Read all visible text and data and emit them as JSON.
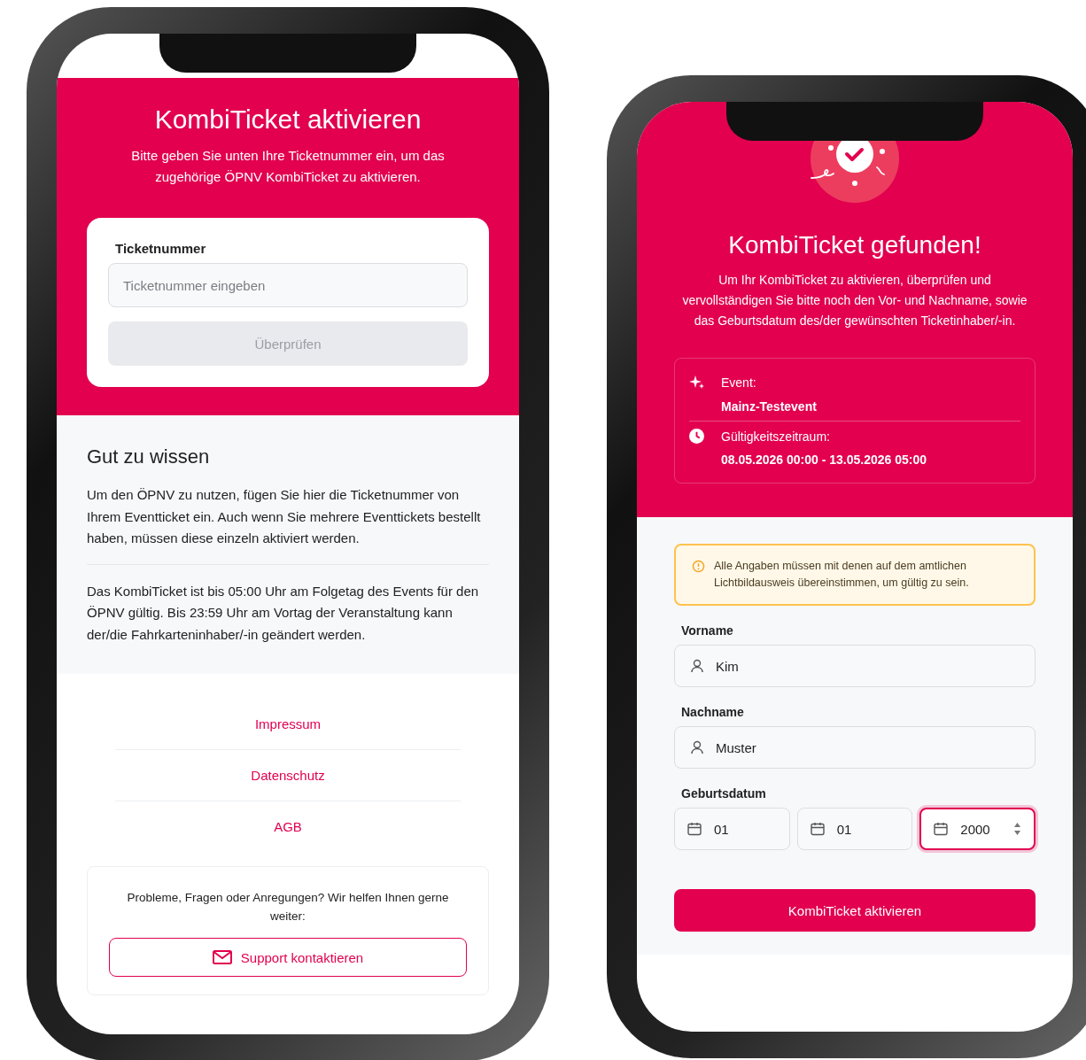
{
  "screen_ticket_entry": {
    "title": "KombiTicket aktivieren",
    "subtitle": "Bitte geben Sie unten Ihre Ticketnummer ein, um das zugehörige ÖPNV KombiTicket zu aktivieren.",
    "form": {
      "label": "Ticketnummer",
      "placeholder": "Ticketnummer eingeben",
      "button": {
        "label": "Überprüfen",
        "disabled": true
      }
    },
    "info": {
      "heading": "Gut zu wissen",
      "paragraphs": [
        "Um den ÖPNV zu nutzen, fügen Sie hier die Ticketnummer von Ihrem Eventticket ein. Auch wenn Sie mehrere Eventtickets bestellt haben, müssen diese einzeln aktiviert werden.",
        "Das KombiTicket ist bis 05:00 Uhr am Folgetag des Events für den ÖPNV gültig. Bis 23:59 Uhr am Vortag der Veranstaltung kann der/die Fahrkarteninhaber/-in geändert werden."
      ]
    },
    "footer_links": [
      "Impressum",
      "Datenschutz",
      "AGB"
    ],
    "support": {
      "text": "Probleme, Fragen oder Anregungen? Wir helfen Ihnen gerne weiter:",
      "button": "Support kontaktieren"
    }
  },
  "screen_ticket_found": {
    "title": "KombiTicket gefunden!",
    "subtitle": "Um Ihr KombiTicket zu aktivieren, überprüfen und vervollständigen Sie bitte noch den Vor- und Nachname, sowie das Geburtsdatum des/der gewünschten Ticketinhaber/-in.",
    "details": [
      {
        "kind": "event",
        "label": "Event:",
        "value": "Mainz-Testevent"
      },
      {
        "kind": "validity",
        "label": "Gültigkeitszeitraum:",
        "value": "08.05.2026 00:00 - 13.05.2026 05:00"
      }
    ],
    "notice": "Alle Angaben müssen mit denen auf dem amtlichen Lichtbildausweis übereinstimmen, um gültig zu sein.",
    "fields": [
      {
        "label": "Vorname",
        "value": "Kim"
      },
      {
        "label": "Nachname",
        "value": "Muster"
      }
    ],
    "birthdate": {
      "label": "Geburtsdatum",
      "parts": [
        {
          "value": "01",
          "focused": false
        },
        {
          "value": "01",
          "focused": false
        },
        {
          "value": "2000",
          "focused": true
        }
      ]
    },
    "button": {
      "label": "KombiTicket aktivieren",
      "disabled": false
    }
  }
}
